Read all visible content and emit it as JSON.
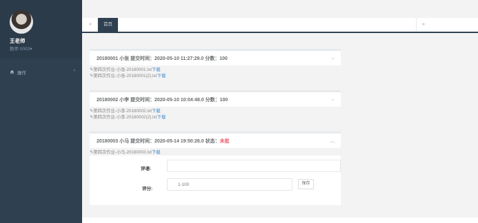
{
  "sidebar": {
    "user_name": "王老师",
    "user_role": "教师 0002",
    "nav": [
      {
        "label": "操作",
        "icon": "home-icon"
      }
    ]
  },
  "tabs": {
    "prev": "«",
    "home": "首页",
    "next": "»"
  },
  "submissions": [
    {
      "header": "20180001 小张   提交时间：2020-05-10 11:27:29.0   分数：100",
      "files": [
        {
          "name": "✎第四次作业-小张-20180001.txt",
          "action": "下载"
        },
        {
          "name": "✎第四次作业-小张-20180001(2).txt",
          "action": "下载"
        }
      ],
      "expanded": false
    },
    {
      "header": "20180002 小李   提交时间：2020-05-10 10:04:48.0   分数：100",
      "files": [
        {
          "name": "✎第四次作业-小李-20180002.txt",
          "action": "下载"
        },
        {
          "name": "✎第四次作业-小李-20180002(2).txt",
          "action": "下载"
        }
      ],
      "expanded": false
    },
    {
      "header": "20180003 小马   提交时间：2020-05-14 19:50:26.0   状态：",
      "status": "未批",
      "status_color": "#ed5565",
      "files": [
        {
          "name": "✎第四次作业-小马-20180003.txt",
          "action": "下载"
        }
      ],
      "expanded": true
    }
  ],
  "review": {
    "comment_label": "评语:",
    "comment_value": "",
    "score_label": "评分:",
    "score_placeholder": "1-100",
    "save_label": "保存"
  },
  "colors": {
    "sidebar": "#2f4050",
    "accent_link": "#428bca"
  }
}
